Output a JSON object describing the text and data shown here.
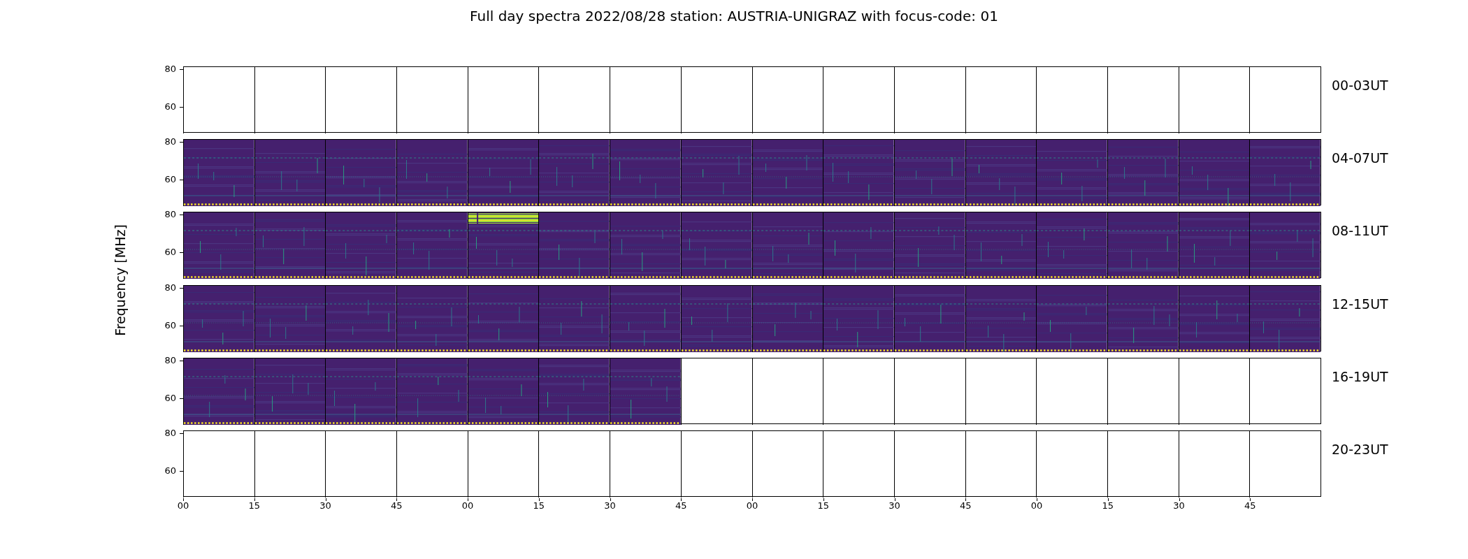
{
  "title": "Full day spectra 2022/08/28 station: AUSTRIA-UNIGRAZ with focus-code: 01",
  "ylabel": "Frequency [MHz]",
  "rows": [
    {
      "label": "00-03UT",
      "yticks": [
        "80",
        "60"
      ],
      "panels": [
        {
          "kind": "empty"
        },
        {
          "kind": "empty"
        },
        {
          "kind": "empty"
        },
        {
          "kind": "empty"
        },
        {
          "kind": "empty"
        },
        {
          "kind": "empty"
        },
        {
          "kind": "empty"
        },
        {
          "kind": "empty"
        },
        {
          "kind": "empty"
        },
        {
          "kind": "empty"
        },
        {
          "kind": "empty"
        },
        {
          "kind": "empty"
        },
        {
          "kind": "empty"
        },
        {
          "kind": "empty"
        },
        {
          "kind": "empty"
        },
        {
          "kind": "empty"
        }
      ]
    },
    {
      "label": "04-07UT",
      "yticks": [
        "80",
        "60"
      ],
      "panels": [
        {
          "kind": "spectrum"
        },
        {
          "kind": "spectrum"
        },
        {
          "kind": "spectrum"
        },
        {
          "kind": "spectrum"
        },
        {
          "kind": "spectrum"
        },
        {
          "kind": "spectrum"
        },
        {
          "kind": "spectrum"
        },
        {
          "kind": "spectrum"
        },
        {
          "kind": "spectrum"
        },
        {
          "kind": "spectrum"
        },
        {
          "kind": "spectrum"
        },
        {
          "kind": "spectrum"
        },
        {
          "kind": "spectrum"
        },
        {
          "kind": "spectrum"
        },
        {
          "kind": "spectrum"
        },
        {
          "kind": "spectrum"
        }
      ]
    },
    {
      "label": "08-11UT",
      "yticks": [
        "80",
        "60"
      ],
      "panels": [
        {
          "kind": "spectrum"
        },
        {
          "kind": "spectrum"
        },
        {
          "kind": "spectrum"
        },
        {
          "kind": "spectrum"
        },
        {
          "kind": "burst"
        },
        {
          "kind": "spectrum"
        },
        {
          "kind": "spectrum"
        },
        {
          "kind": "spectrum"
        },
        {
          "kind": "spectrum"
        },
        {
          "kind": "spectrum"
        },
        {
          "kind": "spectrum"
        },
        {
          "kind": "spectrum"
        },
        {
          "kind": "spectrum"
        },
        {
          "kind": "spectrum"
        },
        {
          "kind": "spectrum"
        },
        {
          "kind": "spectrum"
        }
      ]
    },
    {
      "label": "12-15UT",
      "yticks": [
        "80",
        "60"
      ],
      "panels": [
        {
          "kind": "spectrum"
        },
        {
          "kind": "spectrum"
        },
        {
          "kind": "spectrum"
        },
        {
          "kind": "spectrum"
        },
        {
          "kind": "spectrum"
        },
        {
          "kind": "spectrum"
        },
        {
          "kind": "spectrum"
        },
        {
          "kind": "spectrum"
        },
        {
          "kind": "spectrum"
        },
        {
          "kind": "spectrum"
        },
        {
          "kind": "spectrum"
        },
        {
          "kind": "spectrum"
        },
        {
          "kind": "spectrum"
        },
        {
          "kind": "spectrum"
        },
        {
          "kind": "spectrum"
        },
        {
          "kind": "spectrum"
        }
      ]
    },
    {
      "label": "16-19UT",
      "yticks": [
        "80",
        "60"
      ],
      "panels": [
        {
          "kind": "spectrum"
        },
        {
          "kind": "spectrum"
        },
        {
          "kind": "spectrum"
        },
        {
          "kind": "spectrum"
        },
        {
          "kind": "spectrum"
        },
        {
          "kind": "spectrum"
        },
        {
          "kind": "spectrum"
        },
        {
          "kind": "empty"
        },
        {
          "kind": "empty"
        },
        {
          "kind": "empty"
        },
        {
          "kind": "empty"
        },
        {
          "kind": "empty"
        },
        {
          "kind": "empty"
        },
        {
          "kind": "empty"
        },
        {
          "kind": "empty"
        },
        {
          "kind": "empty"
        }
      ]
    },
    {
      "label": "20-23UT",
      "yticks": [
        "80",
        "60"
      ],
      "panels": [
        {
          "kind": "empty"
        },
        {
          "kind": "empty"
        },
        {
          "kind": "empty"
        },
        {
          "kind": "empty"
        },
        {
          "kind": "empty"
        },
        {
          "kind": "empty"
        },
        {
          "kind": "empty"
        },
        {
          "kind": "empty"
        },
        {
          "kind": "empty"
        },
        {
          "kind": "empty"
        },
        {
          "kind": "empty"
        },
        {
          "kind": "empty"
        },
        {
          "kind": "empty"
        },
        {
          "kind": "empty"
        },
        {
          "kind": "empty"
        },
        {
          "kind": "empty"
        }
      ]
    }
  ],
  "xticks": [
    "00",
    "15",
    "30",
    "45",
    "00",
    "15",
    "30",
    "45",
    "00",
    "15",
    "30",
    "45",
    "00",
    "15",
    "30",
    "45"
  ]
}
